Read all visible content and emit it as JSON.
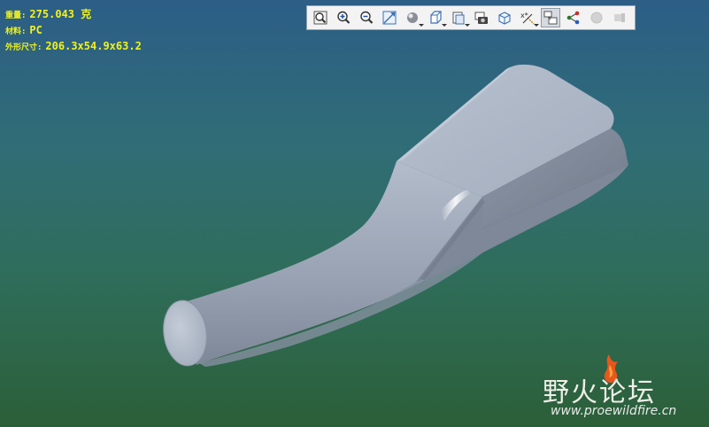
{
  "model_info": {
    "mass_label": "重量:",
    "mass_value": "275.043 克",
    "material_label": "材料:",
    "material_value": "PC",
    "size_label": "外形尺寸:",
    "size_value": "206.3x54.9x63.2"
  },
  "toolbar": {
    "tools": [
      {
        "name": "zoom-fit-icon"
      },
      {
        "name": "zoom-in-icon"
      },
      {
        "name": "zoom-out-icon"
      },
      {
        "name": "repaint-icon"
      },
      {
        "name": "shading-style-icon"
      },
      {
        "name": "saved-views-icon"
      },
      {
        "name": "view-manager-icon"
      },
      {
        "name": "camera-icon"
      },
      {
        "name": "spin-center-icon"
      },
      {
        "name": "datum-display-icon"
      },
      {
        "name": "annotation-display-icon"
      },
      {
        "name": "network-icon"
      },
      {
        "name": "disabled-circle-icon"
      },
      {
        "name": "disabled-tool-icon"
      }
    ]
  },
  "watermark": {
    "title": "野火论坛",
    "url": "www.proewildfire.cn"
  },
  "colors": {
    "info_text": "#f2f21c",
    "model_body": "#a8b2c2",
    "background_top": "#2c5e86",
    "background_bottom": "#2b5f38"
  }
}
